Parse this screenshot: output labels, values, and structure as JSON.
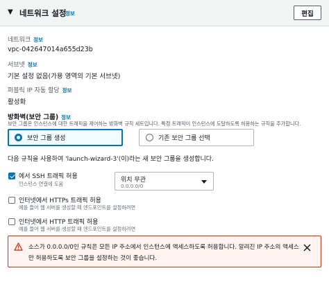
{
  "header": {
    "title": "네트워크 설정",
    "info": "정보",
    "edit_label": "편집"
  },
  "fields": {
    "network": {
      "label": "네트워크",
      "info": "정보",
      "value": "vpc-042647014a655d23b"
    },
    "subnet": {
      "label": "서브넷",
      "info": "정보",
      "value": "기본 설정 없음(가용 영역의 기본 서브넷)"
    },
    "public_ip": {
      "label": "퍼블릭 IP 자동 할당",
      "info": "정보",
      "value": "활성화"
    }
  },
  "firewall": {
    "title": "방화벽(보안 그룹)",
    "info": "정보",
    "description": "보안 그룹은 인스턴스에 대한 트래픽을 제어하는 방화벽 규칙 세트입니다. 특정 트래픽이 인스턴스에 도달하도록 허용하는 규칙을 추가합니다.",
    "options": [
      {
        "label": "보안 그룹 생성",
        "selected": true
      },
      {
        "label": "기존 보안 그룹 선택",
        "selected": false
      }
    ],
    "rule_text": "다음 규칙을 사용하여 'launch-wizard-3'(이)라는 새 보안 그룹을 생성합니다."
  },
  "rules": [
    {
      "label": "에서 SSH 트래픽 허용",
      "sub": "인스턴스 연결에 도움",
      "checked": true
    },
    {
      "label": "인터넷에서 HTTPs 트래픽 허용",
      "sub": "예를 들어 웹 서버를 생성할 때 엔드포인트를 설정하려면",
      "checked": false
    },
    {
      "label": "인터넷에서 HTTP 트래픽 허용",
      "sub": "예를 들어 웹 서버를 생성할 때 엔드포인트를 설정하려면",
      "checked": false
    }
  ],
  "ssh_source": {
    "value": "위치 무관",
    "sub": "0.0.0.0/0"
  },
  "alert": {
    "text": "소스가 0.0.0.0/0인 규칙은 모든 IP 주소에서 인스턴스에 액세스하도록 허용합니다. 알려진 IP 주소의 액세스만 허용하도록 보안 그룹을 설정하는 것이 좋습니다.",
    "icon": "warning-icon",
    "close_icon": "close-icon"
  },
  "colors": {
    "accent": "#0073bb",
    "warning": "#d13212"
  }
}
